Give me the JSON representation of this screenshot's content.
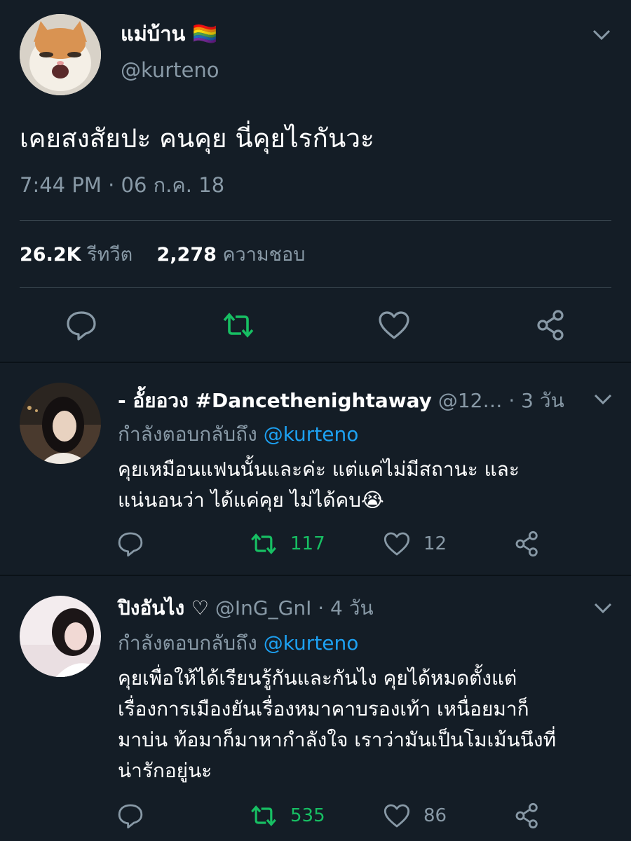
{
  "main_tweet": {
    "display_name": "แม่บ้าน 🏳️‍🌈",
    "handle": "@kurteno",
    "text": "เคยสงสัยปะ คนคุย นี่คุยไรกันวะ",
    "timestamp": "7:44 PM · 06 ก.ค. 18",
    "retweet_count": "26.2K",
    "retweet_label": "รีทวีต",
    "like_count": "2,278",
    "like_label": "ความชอบ",
    "icons": [
      "reply-icon",
      "retweet-icon",
      "like-icon",
      "share-icon"
    ]
  },
  "replies": [
    {
      "display_name": "- อั้ยอวง #Dancethenightaway",
      "handle": "@12…",
      "time": "· 3 วัน",
      "replying_to_label": "กำลังตอบกลับถึง",
      "replying_to": "@kurteno",
      "text_line1": "คุยเหมือนแฟนนั้นและค่ะ แต่แค่ไม่มีสถานะ และ",
      "text_line2": "แน่นอนว่า ได้แค่คุย ไม่ได้คบ😭",
      "retweets": "117",
      "likes": "12"
    },
    {
      "display_name": "ปิงอันไง ♡",
      "handle": "@InG_GnI",
      "time": "· 4 วัน",
      "replying_to_label": "กำลังตอบกลับถึง",
      "replying_to": "@kurteno",
      "text_line1": "คุยเพื่อให้ได้เรียนรู้กันและกันไง คุยได้หมดตั้งแต่",
      "text_line2": "เรื่องการเมืองยันเรื่องหมาคาบรองเท้า เหนื่อยมาก็",
      "text_line3": "มาบ่น ท้อมาก็มาหากำลังใจ เราว่ามันเป็นโมเม้นนึงที่",
      "text_line4": "น่ารักอยู่นะ",
      "retweets": "535",
      "likes": "86"
    }
  ],
  "colors": {
    "background": "#141d26",
    "secondary_text": "#8899a6",
    "link": "#1da1f2",
    "retweet_active": "#17bf63",
    "divider": "#38444d"
  }
}
